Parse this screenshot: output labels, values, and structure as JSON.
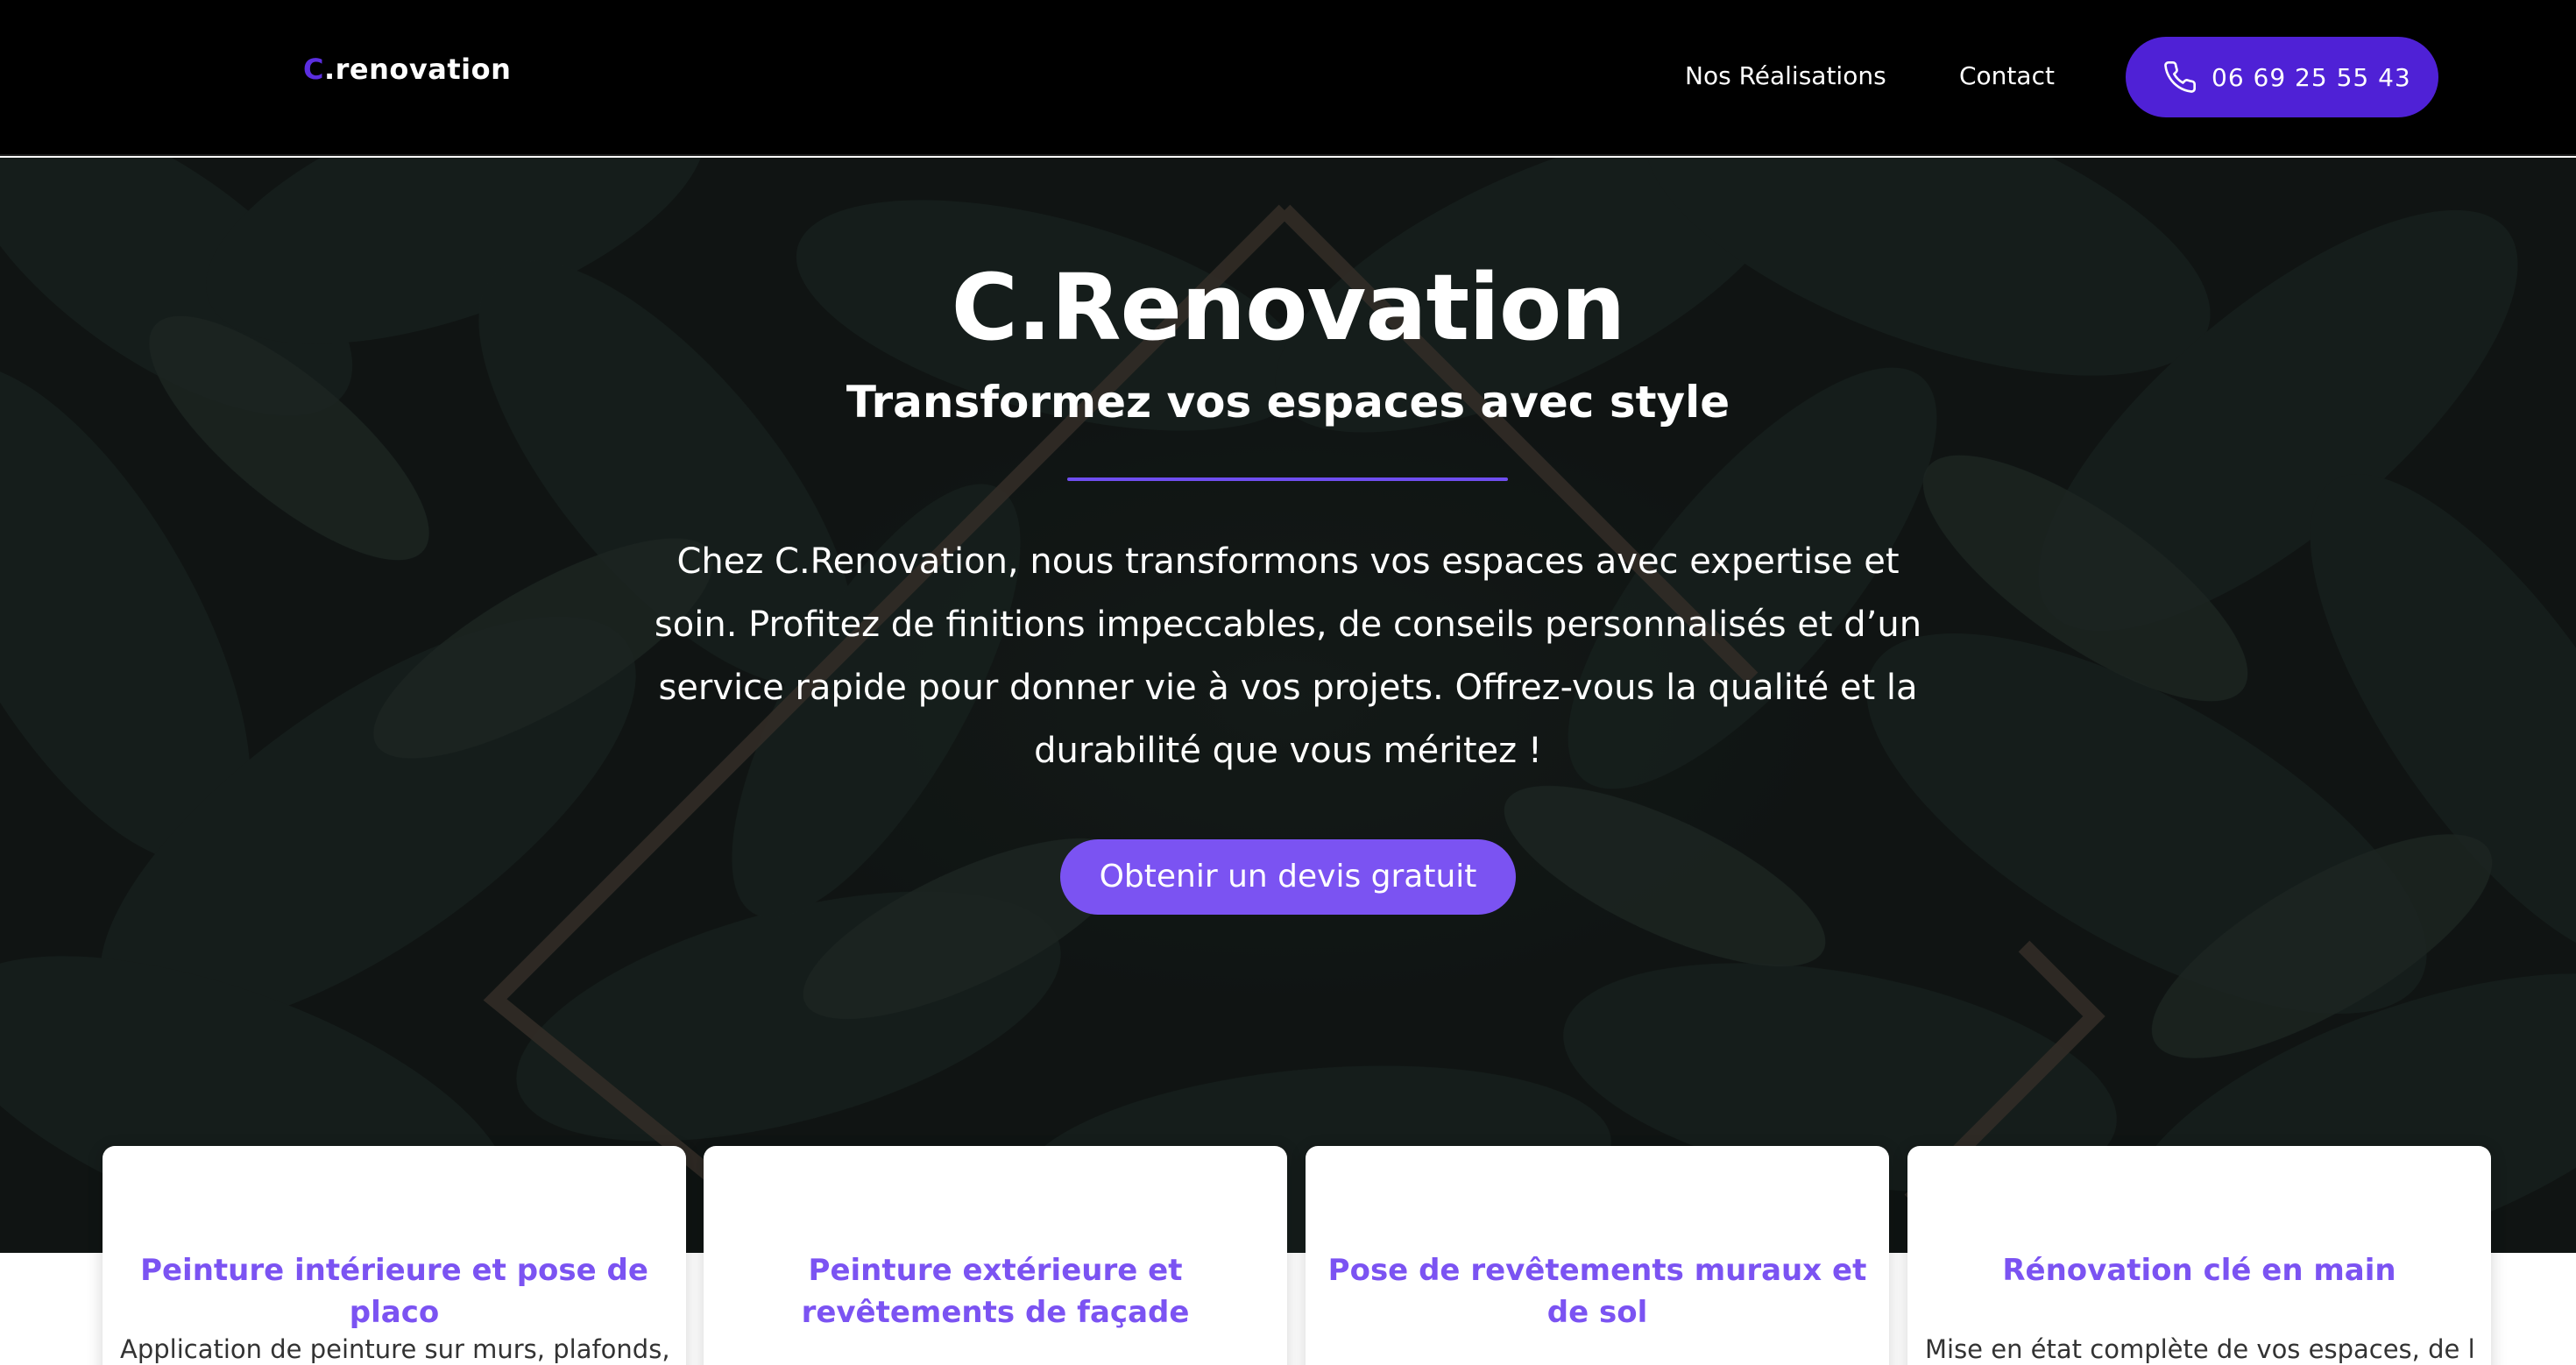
{
  "nav": {
    "logo_prefix": "C",
    "logo_suffix": ".renovation",
    "links": [
      "Nos Réalisations",
      "Contact"
    ],
    "phone": "06 69 25 55 43",
    "phone_icon": "phone-icon",
    "accent_color": "#4f21d6"
  },
  "hero": {
    "title": "C.Renovation",
    "subtitle": "Transformez vos espaces avec style",
    "text": "Chez C.Renovation, nous transformons vos espaces avec expertise et soin. Profitez de finitions impeccables, de conseils personnalisés et d’un service rapide pour donner vie à vos projets. Offrez-vous la qualité et la durabilité que vous méritez !",
    "cta": "Obtenir un devis gratuit",
    "cta_color": "#7b53f2"
  },
  "services": [
    {
      "title": "Peinture intérieure et pose de placo",
      "text": "Application de peinture sur murs, plafonds,"
    },
    {
      "title": "Peinture extérieure et revêtements de façade",
      "text": ""
    },
    {
      "title": "Pose de revêtements muraux et de sol",
      "text": ""
    },
    {
      "title": "Rénovation clé en main",
      "text": "Mise en état complète de vos espaces, de la"
    }
  ]
}
